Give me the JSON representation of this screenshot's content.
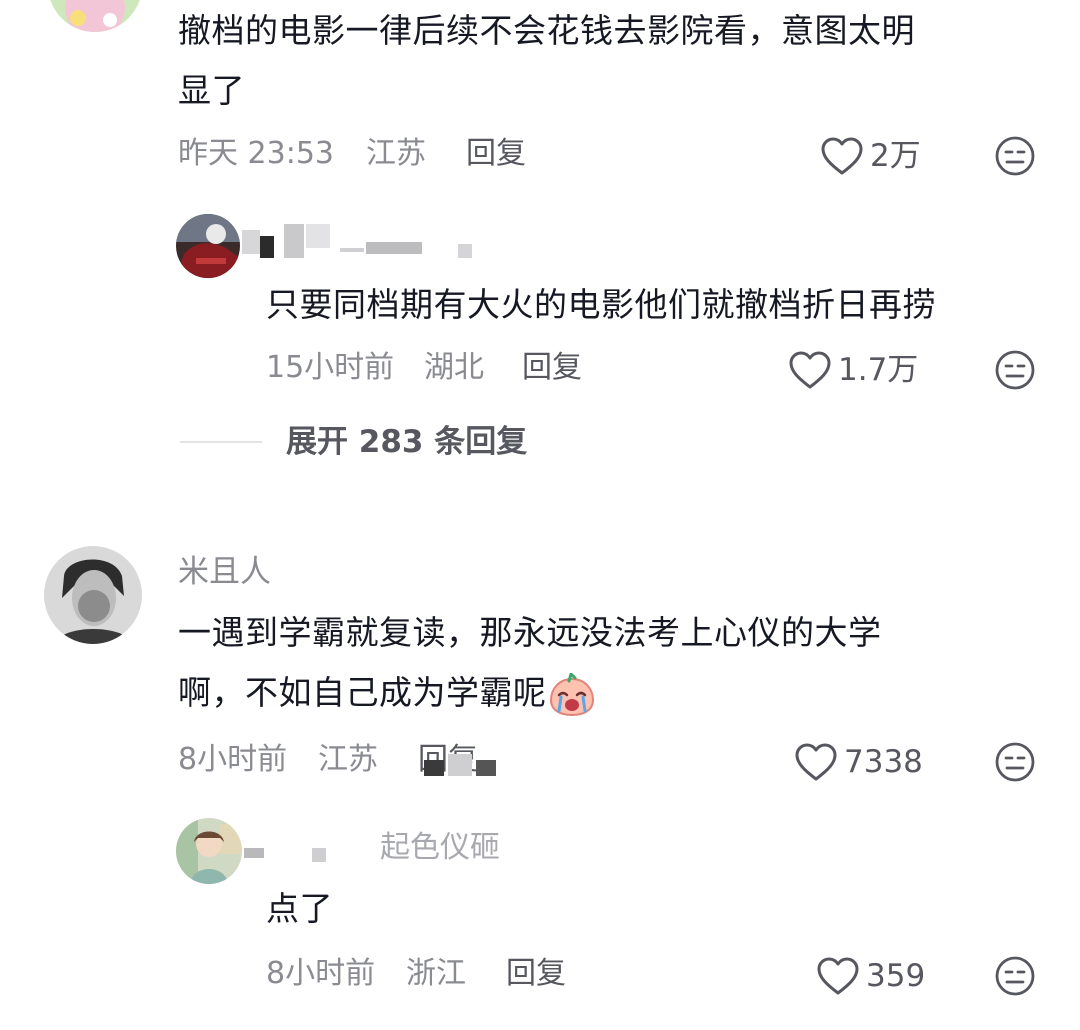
{
  "comments": [
    {
      "text_lines": [
        "撤档的电影一律后续不会花钱去影院看，意图太明",
        "显了"
      ],
      "time": "昨天 23:53",
      "location": "江苏",
      "reply_label": "回复",
      "likes": "2万"
    },
    {
      "username": "米且人",
      "text_lines": [
        "一遇到学霸就复读，那永远没法考上心仪的大学",
        "啊，不如自己成为学霸呢"
      ],
      "emoji": "crying-face-emoji",
      "time": "8小时前",
      "location": "江苏",
      "reply_label": "回复",
      "likes": "7338"
    }
  ],
  "replies": [
    {
      "text": "只要同档期有大火的电影他们就撤档折日再捞",
      "time": "15小时前",
      "location": "湖北",
      "reply_label": "回复",
      "likes": "1.7万"
    },
    {
      "username_partial": "起色仪砸",
      "text": "点了",
      "time": "8小时前",
      "location": "浙江",
      "reply_label": "回复",
      "likes": "359"
    }
  ],
  "expand_replies_label": "展开 283 条回复",
  "icons": {
    "like": "heart-outline-icon",
    "dislike": "neutral-face-icon"
  },
  "colors": {
    "primary_text": "#161823",
    "secondary_text": "#8a8b91",
    "action_text": "#57585f"
  }
}
